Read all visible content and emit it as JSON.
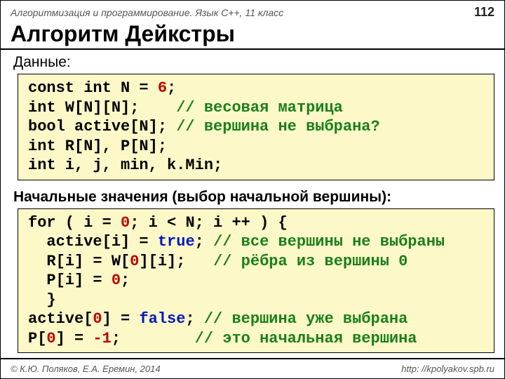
{
  "header": {
    "course": "Алгоритмизация и программирование. Язык C++, 11 класс",
    "page": "112"
  },
  "title": "Алгоритм Дейкстры",
  "section1_label": "Данные:",
  "code1": {
    "l1a": "const int N = ",
    "l1n": "6",
    "l1b": ";",
    "l2a": "int W[N][N];    ",
    "l2c": "// весовая матрица",
    "l3a": "bool active[N]; ",
    "l3c": "// вершина не выбрана?",
    "l4": "int R[N], P[N];",
    "l5": "int i, j, min, k.Min;"
  },
  "section2_label": "Начальные значения (выбор начальной вершины):",
  "code2": {
    "l1a": "for ( i = ",
    "l1n": "0",
    "l1b": "; i < N; i ++ ) {",
    "l2a": "  active[i] = ",
    "l2t": "true",
    "l2b": "; ",
    "l2c": "// все вершины не выбраны",
    "l3a": "  R[i] = W[",
    "l3n1": "0",
    "l3b": "][i];   ",
    "l3c": "// рёбра из вершины 0",
    "l4a": "  P[i] = ",
    "l4n": "0",
    "l4b": ";",
    "l5": "  }",
    "l6a": "active[",
    "l6n": "0",
    "l6b": "] = ",
    "l6f": "false",
    "l6c1": "; ",
    "l6c": "// вершина уже выбрана",
    "l7a": "P[",
    "l7n1": "0",
    "l7b": "] = ",
    "l7n2": "-1",
    "l7c1": ";        ",
    "l7c": "// это начальная вершина"
  },
  "footer": {
    "left": "© К.Ю. Поляков, Е.А. Еремин, 2014",
    "right": "http: //kpolyakov.spb.ru"
  }
}
